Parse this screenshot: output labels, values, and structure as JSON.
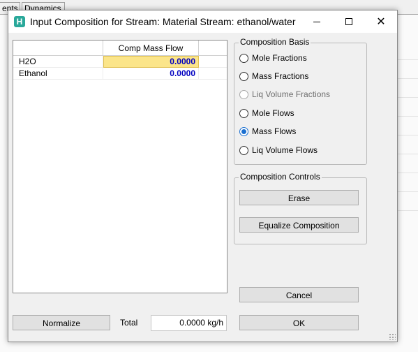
{
  "background": {
    "tabs": [
      "ents",
      "Dynamics"
    ]
  },
  "dialog": {
    "icon_letter": "H",
    "title": "Input Composition for Stream: Material Stream: ethanol/water",
    "window_controls": {
      "minimize": "minimize-icon",
      "maximize": "maximize-icon",
      "close": "✕"
    }
  },
  "grid": {
    "column_header": "Comp Mass Flow",
    "rows": [
      {
        "name": "H2O",
        "value": "0.0000"
      },
      {
        "name": "Ethanol",
        "value": "0.0000"
      }
    ]
  },
  "composition_basis": {
    "title": "Composition Basis",
    "options": [
      {
        "label": "Mole Fractions",
        "checked": false,
        "enabled": true
      },
      {
        "label": "Mass Fractions",
        "checked": false,
        "enabled": true
      },
      {
        "label": "Liq Volume Fractions",
        "checked": false,
        "enabled": false
      },
      {
        "label": "Mole Flows",
        "checked": false,
        "enabled": true
      },
      {
        "label": "Mass Flows",
        "checked": true,
        "enabled": true
      },
      {
        "label": "Liq Volume Flows",
        "checked": false,
        "enabled": true
      }
    ]
  },
  "composition_controls": {
    "title": "Composition Controls",
    "erase_label": "Erase",
    "equalize_label": "Equalize Composition"
  },
  "footer": {
    "normalize_label": "Normalize",
    "total_label": "Total",
    "total_value": "0.0000 kg/h",
    "cancel_label": "Cancel",
    "ok_label": "OK"
  },
  "colors": {
    "accent_radio": "#1a6fd0",
    "selected_cell": "#fbe58a",
    "value_text": "#0000c0",
    "app_icon": "#2aa89a"
  }
}
